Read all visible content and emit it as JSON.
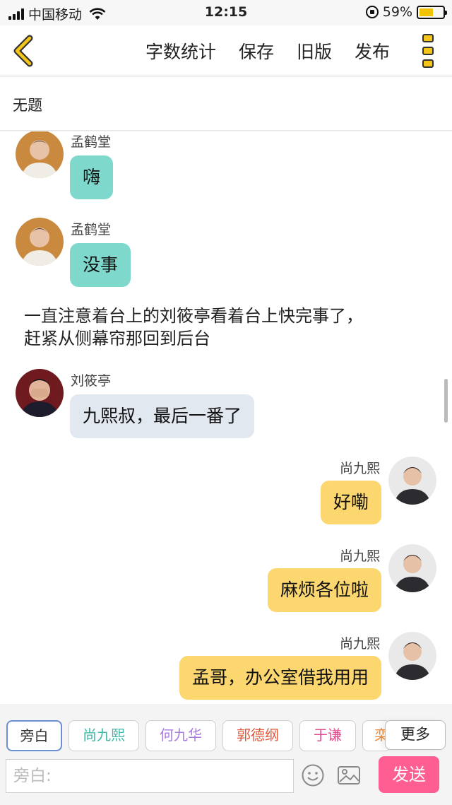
{
  "status_bar": {
    "carrier": "中国移动",
    "time": "12:15",
    "battery": "59%",
    "battery_level": 0.59
  },
  "header": {
    "actions": [
      "字数统计",
      "保存",
      "旧版",
      "发布"
    ]
  },
  "doc_title": "无题",
  "messages": [
    {
      "side": "left",
      "speaker": "孟鹤堂",
      "text": "嗨",
      "color": "#7fd8cc"
    },
    {
      "side": "left",
      "speaker": "孟鹤堂",
      "text": "没事",
      "color": "#7fd8cc"
    },
    {
      "type": "narration",
      "lines": [
        "一直注意着台上的刘筱亭看着台上快完事了，",
        "赶紧从侧幕帘那回到后台"
      ]
    },
    {
      "side": "left",
      "speaker": "刘筱亭",
      "text": "九熙叔，最后一番了",
      "color": "#e2e8f0"
    },
    {
      "side": "right",
      "speaker": "尚九熙",
      "text": "好嘞",
      "color": "#fcd770"
    },
    {
      "side": "right",
      "speaker": "尚九熙",
      "text": "麻烦各位啦",
      "color": "#fcd770"
    },
    {
      "side": "right",
      "speaker": "尚九熙",
      "text": "孟哥，办公室借我用用",
      "color": "#fcd770"
    }
  ],
  "roles": [
    {
      "label": "旁白",
      "color": "#333333",
      "active": true
    },
    {
      "label": "尚九熙",
      "color": "#3fb8a8"
    },
    {
      "label": "何九华",
      "color": "#a77be0"
    },
    {
      "label": "郭德纲",
      "color": "#e0573a"
    },
    {
      "label": "于谦",
      "color": "#e24b8c"
    },
    {
      "label": "栾",
      "color": "#f08b3a"
    }
  ],
  "more_roles": "更多",
  "input": {
    "placeholder": "旁白:"
  },
  "send_label": "发送"
}
